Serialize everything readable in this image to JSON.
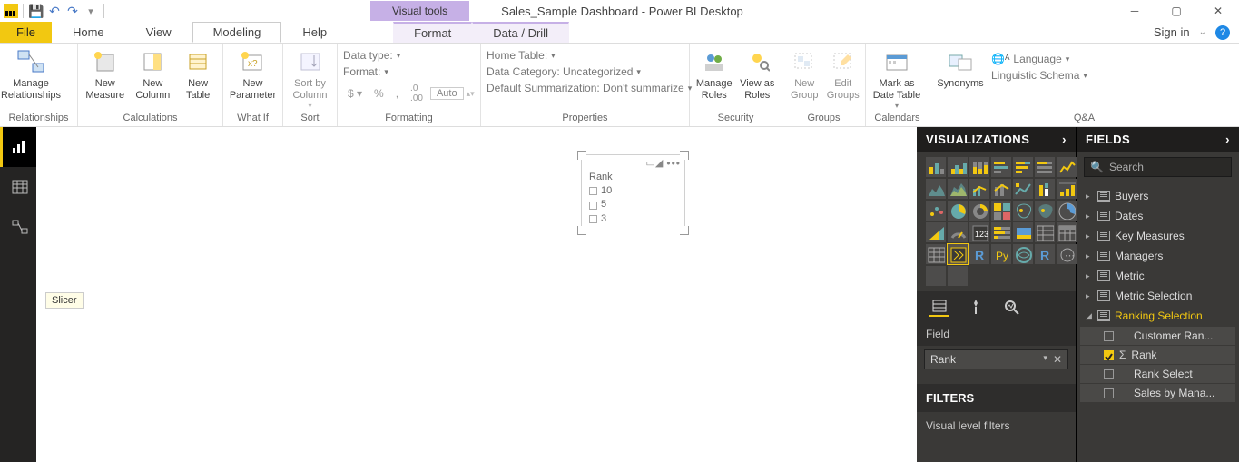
{
  "titlebar": {
    "app_title": "Sales_Sample Dashboard - Power BI Desktop",
    "contextual_tab": "Visual tools"
  },
  "tabs": {
    "file": "File",
    "items": [
      "Home",
      "View",
      "Modeling",
      "Help"
    ],
    "active": "Modeling",
    "contextual": [
      "Format",
      "Data / Drill"
    ],
    "signin": "Sign in"
  },
  "ribbon": {
    "groups": [
      {
        "label": "Relationships",
        "buttons": [
          {
            "l1": "Manage",
            "l2": "Relationships"
          }
        ]
      },
      {
        "label": "Calculations",
        "buttons": [
          {
            "l1": "New",
            "l2": "Measure"
          },
          {
            "l1": "New",
            "l2": "Column"
          },
          {
            "l1": "New",
            "l2": "Table"
          }
        ]
      },
      {
        "label": "What If",
        "buttons": [
          {
            "l1": "New",
            "l2": "Parameter"
          }
        ]
      },
      {
        "label": "Sort",
        "buttons": [
          {
            "l1": "Sort by",
            "l2": "Column"
          }
        ]
      },
      {
        "label": "Formatting",
        "props": {
          "data_type": "Data type:",
          "format": "Format:",
          "symbols": [
            "$",
            "%",
            ",",
            ".0",
            ".00"
          ],
          "auto": "Auto"
        }
      },
      {
        "label": "Properties",
        "props": {
          "home_table": "Home Table:",
          "data_category": "Data Category: Uncategorized",
          "default_summ": "Default Summarization: Don't summarize"
        }
      },
      {
        "label": "Security",
        "buttons": [
          {
            "l1": "Manage",
            "l2": "Roles"
          },
          {
            "l1": "View as",
            "l2": "Roles"
          }
        ]
      },
      {
        "label": "Groups",
        "buttons": [
          {
            "l1": "New",
            "l2": "Group"
          },
          {
            "l1": "Edit",
            "l2": "Groups"
          }
        ]
      },
      {
        "label": "Calendars",
        "buttons": [
          {
            "l1": "Mark as",
            "l2": "Date Table"
          }
        ]
      },
      {
        "label": "Q&A",
        "buttons": [
          {
            "l1": "Synonyms",
            "l2": ""
          }
        ],
        "extras": {
          "language": "Language",
          "schema": "Linguistic Schema"
        }
      }
    ]
  },
  "slicer": {
    "title": "Rank",
    "items": [
      "10",
      "5",
      "3"
    ]
  },
  "viz_panel": {
    "title": "VISUALIZATIONS",
    "tooltip": "Slicer",
    "field_label": "Field",
    "field_value": "Rank",
    "filters_title": "FILTERS",
    "filters_sub": "Visual level filters"
  },
  "fields_panel": {
    "title": "FIELDS",
    "search_placeholder": "Search",
    "tables": [
      {
        "name": "Buyers",
        "expanded": false
      },
      {
        "name": "Dates",
        "expanded": false
      },
      {
        "name": "Key Measures",
        "expanded": false
      },
      {
        "name": "Managers",
        "expanded": false
      },
      {
        "name": "Metric",
        "expanded": false
      },
      {
        "name": "Metric Selection",
        "expanded": false
      },
      {
        "name": "Ranking Selection",
        "expanded": true,
        "highlight": true,
        "fields": [
          {
            "name": "Customer Ran...",
            "checked": false
          },
          {
            "name": "Rank",
            "checked": true,
            "sigma": true
          },
          {
            "name": "Rank Select",
            "checked": false
          },
          {
            "name": "Sales by Mana...",
            "checked": false
          }
        ]
      }
    ]
  }
}
